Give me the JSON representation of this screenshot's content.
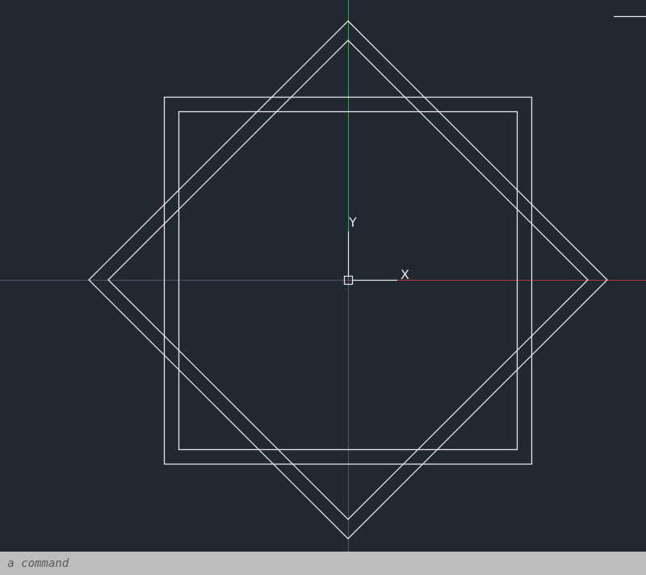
{
  "ucs": {
    "x_label": "X",
    "y_label": "Y"
  },
  "command_line": {
    "placeholder": "pe a command"
  },
  "colors": {
    "background": "#212830",
    "geometry": "#e6e6e6",
    "x_axis": "#b03a3a",
    "y_axis": "#3aa55a",
    "crosshair": "#4a5868",
    "ucs_icon": "#e6e6e6",
    "command_bar": "#bdbdbd"
  }
}
